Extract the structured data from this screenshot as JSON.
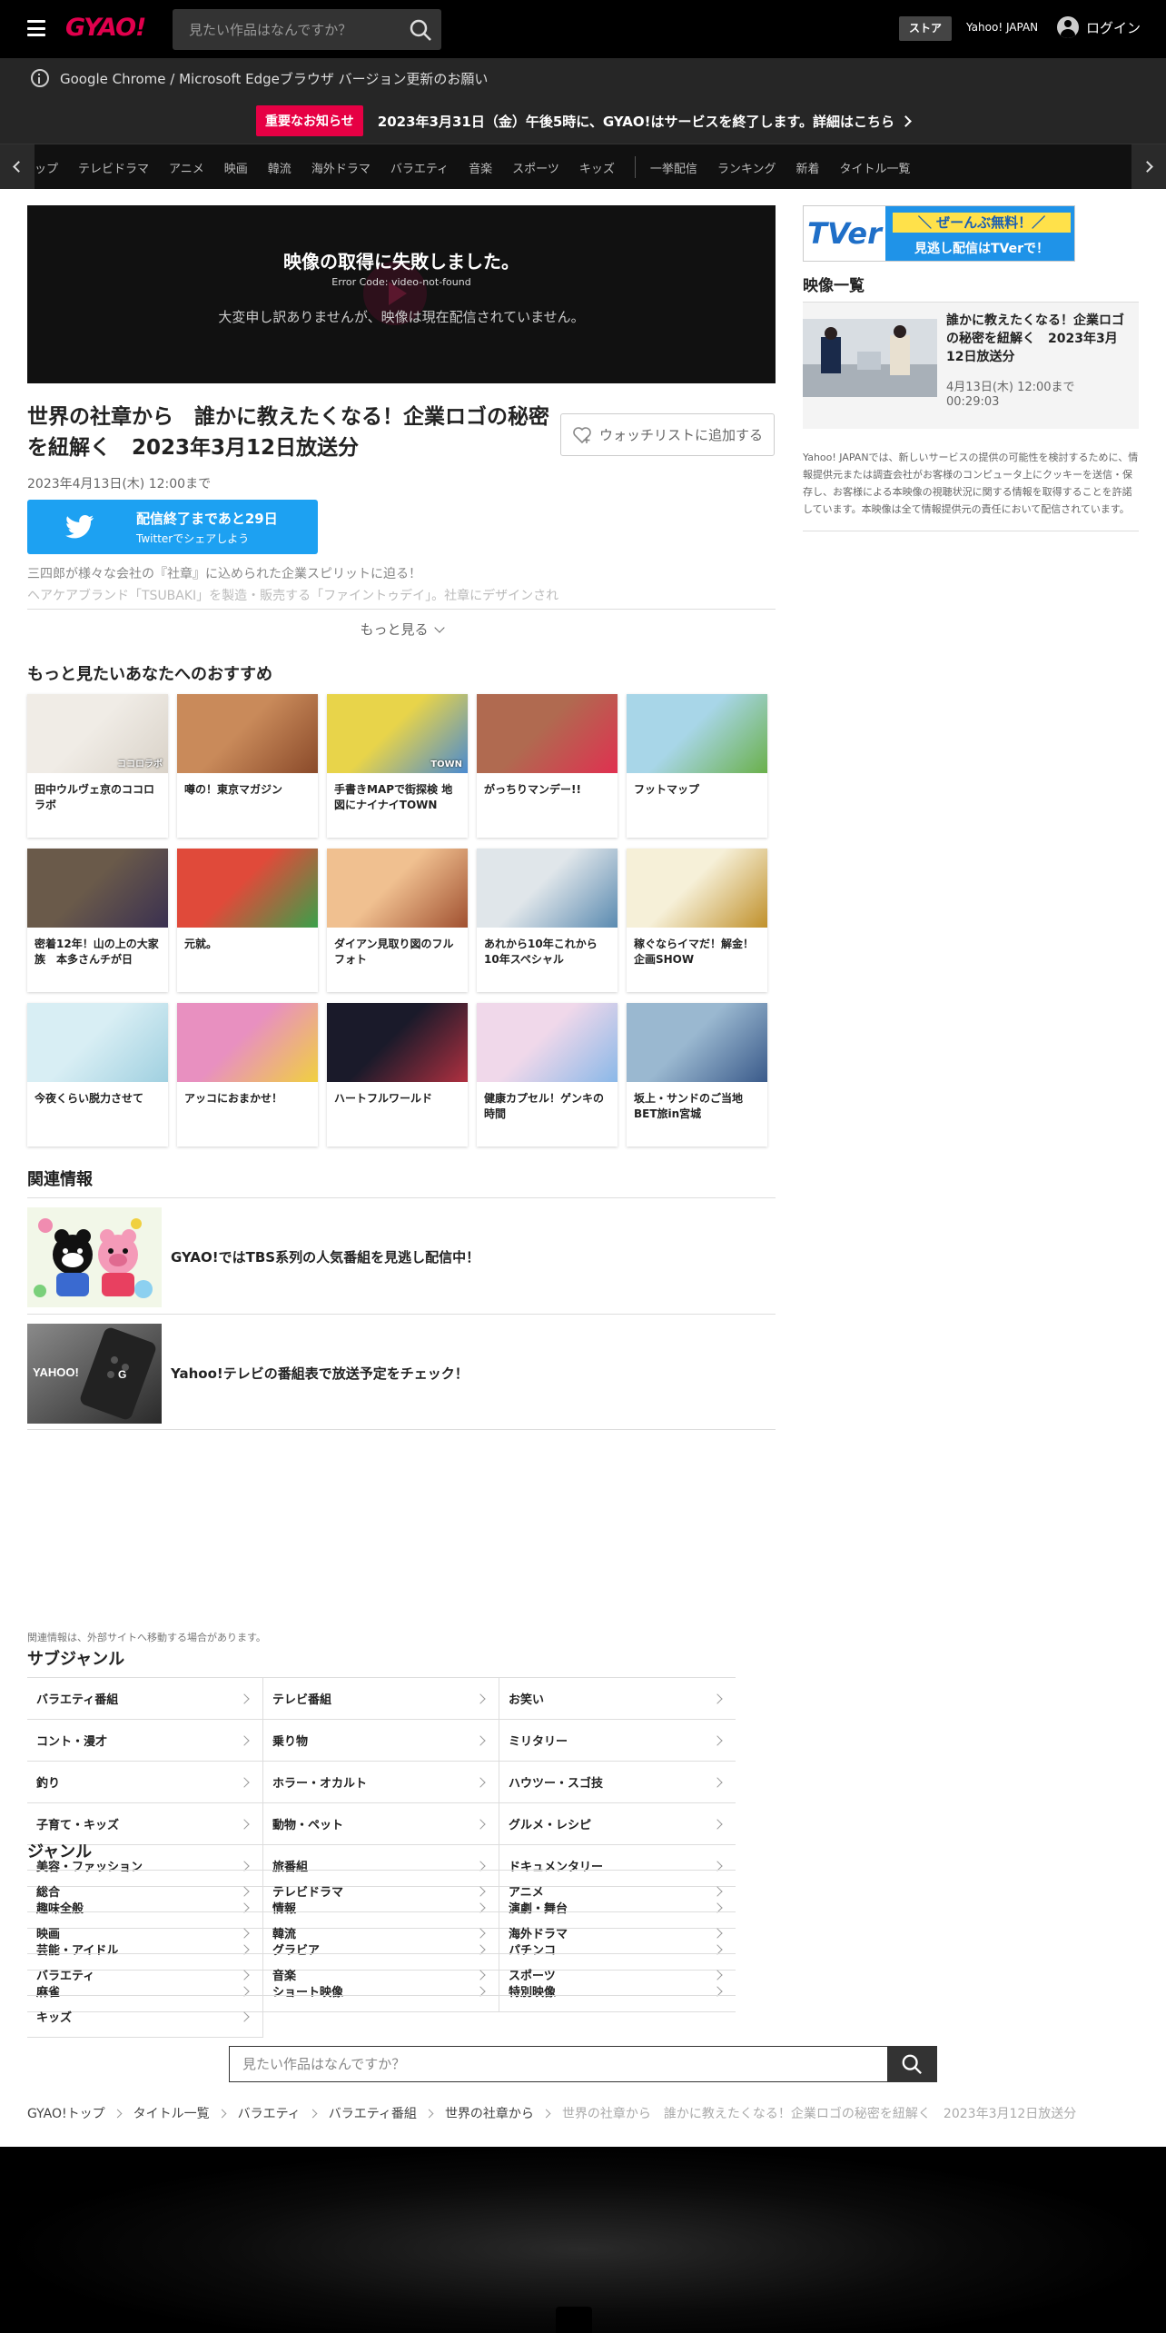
{
  "header": {
    "logo": "GYAO!",
    "search_placeholder": "見たい作品はなんですか？",
    "store": "ストア",
    "yahoo_japan": "Yahoo! JAPAN",
    "login": "ログイン"
  },
  "browser_notice": "Google Chrome / Microsoft Edgeブラウザ バージョン更新のお願い",
  "important": {
    "badge": "重要なお知らせ",
    "text": "2023年3月31日（金）午後5時に、GYAO!はサービスを終了します。詳細はこちら"
  },
  "category_nav": {
    "items": [
      "ップ",
      "テレビドラマ",
      "アニメ",
      "映画",
      "韓流",
      "海外ドラマ",
      "バラエティ",
      "音楽",
      "スポーツ",
      "キッズ"
    ],
    "items2": [
      "一挙配信",
      "ランキング",
      "新着",
      "タイトル一覧"
    ]
  },
  "player": {
    "error_title": "映像の取得に失敗しました。",
    "error_code": "Error Code: video-not-found",
    "error_message": "大変申し訳ありませんが、映像は現在配信されていません。"
  },
  "video": {
    "title": "世界の社章から　誰かに教えたくなる！企業ロゴの秘密を紐解く　2023年3月12日放送分",
    "watchlist": "ウォッチリストに追加する",
    "until": "2023年4月13日(木) 12:00まで",
    "twitter_line1": "配信終了まであと29日",
    "twitter_line2": "Twitterでシェアしよう",
    "desc1": "三四郎が様々な会社の『社章』に込められた企業スピリットに迫る！",
    "desc2": "ヘアケアブランド「TSUBAKI」を製造・販売する「ファイントゥデイ」。社章にデザインされ",
    "more": "もっと見る"
  },
  "recommend": {
    "heading": "もっと見たいあなたへのおすすめ",
    "items": [
      {
        "title": "田中ウルヴェ京のココロラボ",
        "thumb": "ココロラボ",
        "c1": "#f0ece6",
        "c2": "#d9d2c8"
      },
      {
        "title": "噂の！東京マガジン",
        "thumb": "",
        "c1": "#c98a5a",
        "c2": "#8a4a2a"
      },
      {
        "title": "手書きMAPで街探検 地図にナイナイTOWN",
        "thumb": "TOWN",
        "c1": "#e8d44a",
        "c2": "#4a8ad0"
      },
      {
        "title": "がっちりマンデー!!",
        "thumb": "",
        "c1": "#b06a50",
        "c2": "#e03050"
      },
      {
        "title": "フットマップ",
        "thumb": "",
        "c1": "#a8d6e8",
        "c2": "#6ab04a"
      },
      {
        "title": "密着12年！山の上の大家族　本多さんチが日",
        "thumb": "",
        "c1": "#6a5a4a",
        "c2": "#3a3050"
      },
      {
        "title": "元就。",
        "thumb": "",
        "c1": "#e04a3a",
        "c2": "#3aa04a"
      },
      {
        "title": "ダイアン見取り図のフルフォト",
        "thumb": "",
        "c1": "#f0c090",
        "c2": "#a05030"
      },
      {
        "title": "あれから10年これから10年スペシャル",
        "thumb": "",
        "c1": "#e0e6ea",
        "c2": "#5a8ab0"
      },
      {
        "title": "稼ぐならイマだ！解金！企画SHOW",
        "thumb": "",
        "c1": "#f6f0d8",
        "c2": "#c0902a"
      },
      {
        "title": "今夜くらい脱力させて",
        "thumb": "",
        "c1": "#d8eef4",
        "c2": "#a0d0e0"
      },
      {
        "title": "アッコにおまかせ！",
        "thumb": "",
        "c1": "#e890c0",
        "c2": "#f0d040"
      },
      {
        "title": "ハートフルワールド",
        "thumb": "",
        "c1": "#1a1a2a",
        "c2": "#b03040"
      },
      {
        "title": "健康カプセル！ゲンキの時間",
        "thumb": "",
        "c1": "#f0d8ea",
        "c2": "#8ab8e8"
      },
      {
        "title": "坂上・サンドのご当地BET旅in宮城",
        "thumb": "",
        "c1": "#9ab8d0",
        "c2": "#3a5a8a"
      }
    ]
  },
  "related": {
    "heading": "関連情報",
    "items": [
      {
        "title": "GYAO!ではTBS系列の人気番組を見逃し配信中！"
      },
      {
        "title": "Yahoo!テレビの番組表で放送予定をチェック！"
      }
    ],
    "note": "関連情報は、外部サイトへ移動する場合があります。"
  },
  "subgenre": {
    "heading": "サブジャンル",
    "items": [
      "バラエティ番組",
      "テレビ番組",
      "お笑い",
      "コント・漫才",
      "乗り物",
      "ミリタリー",
      "釣り",
      "ホラー・オカルト",
      "ハウツー・スゴ技",
      "子育て・キッズ",
      "動物・ペット",
      "グルメ・レシピ",
      "美容・ファッション",
      "旅番組",
      "ドキュメンタリー",
      "趣味全般",
      "情報",
      "演劇・舞台",
      "芸能・アイドル",
      "グラビア",
      "パチンコ",
      "麻雀",
      "ショート映像",
      "特別映像"
    ]
  },
  "genre": {
    "heading": "ジャンル",
    "items": [
      "総合",
      "テレビドラマ",
      "アニメ",
      "映画",
      "韓流",
      "海外ドラマ",
      "バラエティ",
      "音楽",
      "スポーツ",
      "キッズ"
    ]
  },
  "bottom_search": {
    "placeholder": "見たい作品はなんですか？"
  },
  "breadcrumb": [
    "GYAO!トップ",
    "タイトル一覧",
    "バラエティ",
    "バラエティ番組",
    "世界の社章から",
    "世界の社章から　誰かに教えたくなる！企業ロゴの秘密を紐解く　2023年3月12日放送分"
  ],
  "sidebar": {
    "tver_line1": "＼ ぜーんぶ無料！／",
    "tver_line2": "見逃し配信はTVerで！",
    "tver_logo": "TVer",
    "list_heading": "映像一覧",
    "video_title": "誰かに教えたくなる！企業ロゴの秘密を紐解く　2023年3月12日放送分",
    "video_until": "4月13日(木) 12:00まで",
    "video_duration": "00:29:03",
    "note": "Yahoo! JAPANでは、新しいサービスの提供の可能性を検討するために、情報提供元または調査会社がお客様のコンピュータ上にクッキーを送信・保存し、お客様による本映像の視聴状況に関する情報を取得することを許諾しています。本映像は全て情報提供元の責任において配信されています。"
  },
  "colors": {
    "brand": "#e0004d",
    "twitter": "#1da1f2",
    "tver": "#1f93e8"
  }
}
